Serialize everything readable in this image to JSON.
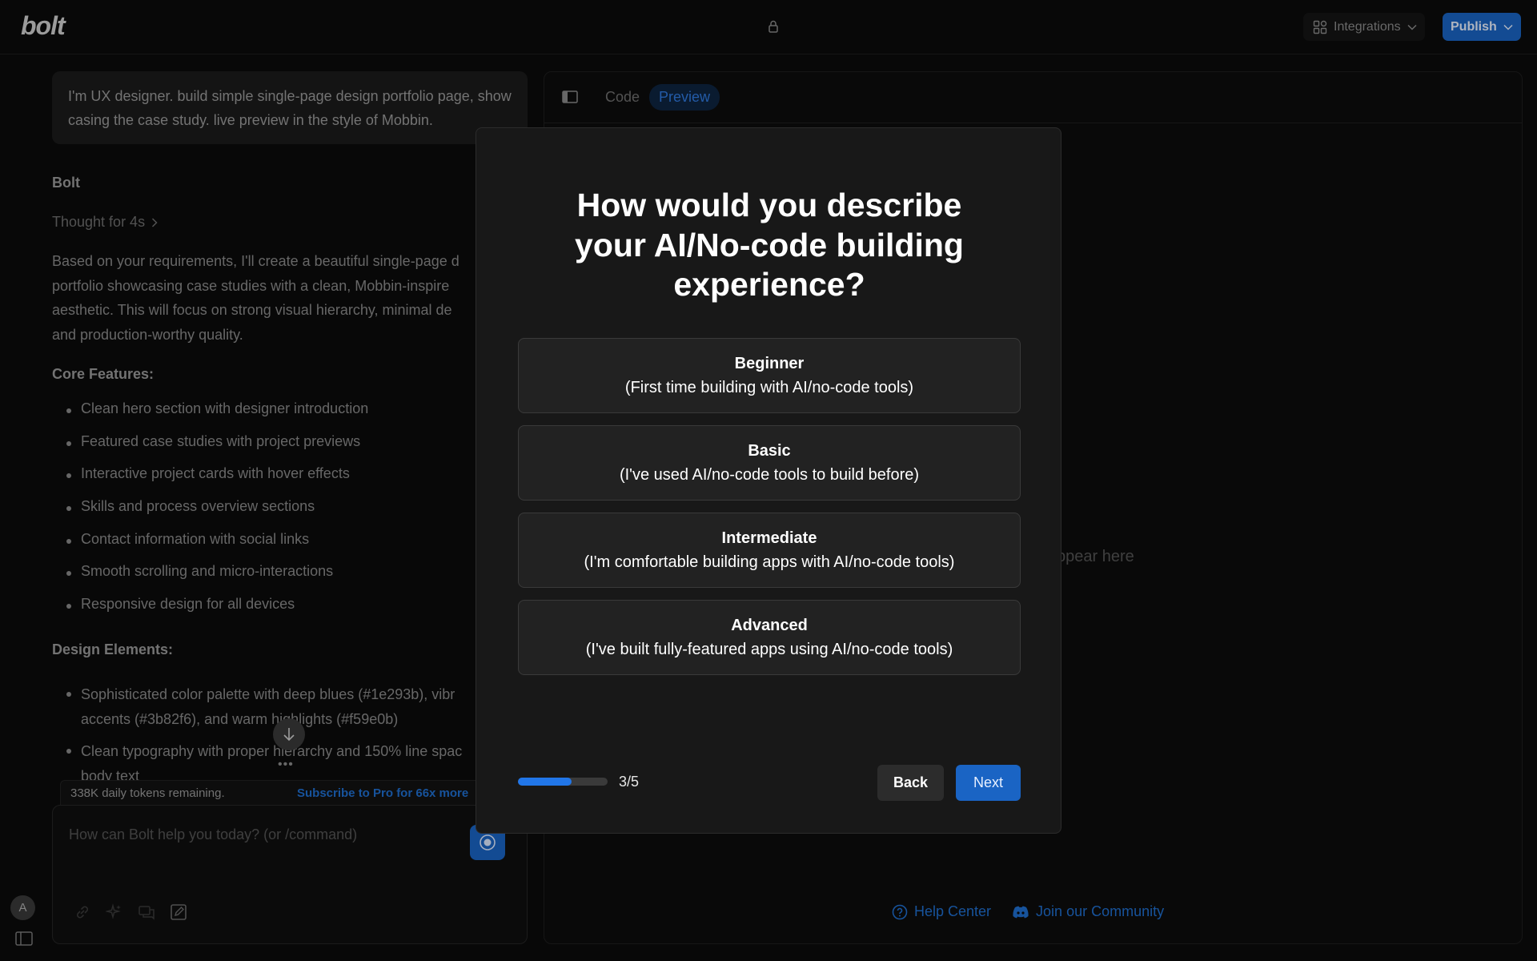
{
  "header": {
    "logo": "bolt",
    "integrations_label": "Integrations",
    "publish_label": "Publish"
  },
  "chat": {
    "user_message": "I'm UX designer. build simple single-page design portfolio page, show casing the case study. live preview in the style of Mobbin.",
    "assistant_name": "Bolt",
    "thought": "Thought for 4s",
    "intro": "Based on your requirements, I'll create a beautiful single-page d\nportfolio showcasing case studies with a clean, Mobbin-inspire\naesthetic. This will focus on strong visual hierarchy, minimal de\nand production-worthy quality.",
    "core_heading": "Core Features:",
    "features": [
      "Clean hero section with designer introduction",
      "Featured case studies with project previews",
      "Interactive project cards with hover effects",
      "Skills and process overview sections",
      "Contact information with social links",
      "Smooth scrolling and micro-interactions",
      "Responsive design for all devices"
    ],
    "design_heading": "Design Elements:",
    "design_items": [
      "Sophisticated color palette with deep blues (#1e293b), vibr\naccents (#3b82f6), and warm highlights (#f59e0b)",
      "Clean typography with proper hierarchy and 150% line spac\nbody text"
    ],
    "loader": "•••",
    "tokens_remaining": "338K daily tokens remaining.",
    "subscribe": "Subscribe to Pro for 66x more",
    "prompt_placeholder": "How can Bolt help you today? (or /command)",
    "avatar_initial": "A"
  },
  "preview": {
    "tabs": [
      "Code",
      "Preview"
    ],
    "active_tab": "Preview",
    "empty_text": "ppear here",
    "help_center": "Help Center",
    "community": "Join our Community"
  },
  "modal": {
    "title": "How would you describe\nyour AI/No-code building\nexperience?",
    "options": [
      {
        "title": "Beginner",
        "desc": "(First time building with AI/no-code tools)"
      },
      {
        "title": "Basic",
        "desc": "(I've used AI/no-code tools to build before)"
      },
      {
        "title": "Intermediate",
        "desc": "(I'm comfortable building apps with AI/no-code tools)"
      },
      {
        "title": "Advanced",
        "desc": "(I've built fully-featured apps using AI/no-code tools)"
      }
    ],
    "progress_fraction": 0.6,
    "progress_label": "3/5",
    "back_label": "Back",
    "next_label": "Next"
  },
  "colors": {
    "accent": "#1a64c4",
    "background": "#0b0b0b",
    "modal_bg": "#181818",
    "option_bg": "#222222"
  }
}
